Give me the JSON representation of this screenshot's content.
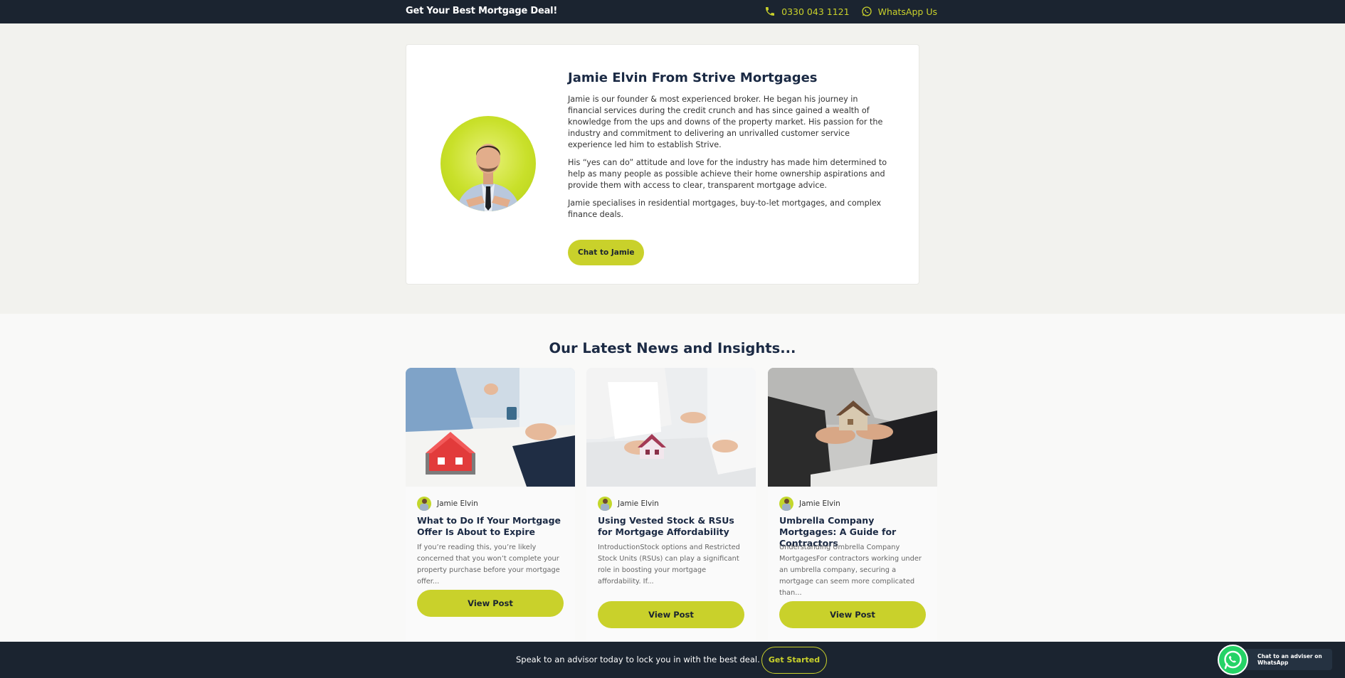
{
  "topbar": {
    "brand": "Get Your Best Mortgage Deal!",
    "phone": "0330 043 1121",
    "whatsapp": "WhatsApp Us",
    "accent": "#c9d12b",
    "background": "#1b2430"
  },
  "profile": {
    "title": "Jamie Elvin From Strive Mortgages",
    "paragraphs": [
      "Jamie is our founder & most experienced broker. He began his journey in financial services during the credit crunch and has since gained a wealth of knowledge from the ups and downs of the property market. His passion for the industry and commitment to delivering an unrivalled customer service experience led him to establish Strive.",
      "His “yes can do” attitude and love for the industry has made him determined to help as many people as possible achieve their home ownership aspirations and provide them with access to clear, transparent mortgage advice.",
      "Jamie specialises in residential mortgages, buy-to-let mortgages, and complex finance deals."
    ],
    "cta": "Chat to Jamie"
  },
  "news": {
    "title": "Our Latest News and Insights...",
    "posts": [
      {
        "author": "Jamie Elvin",
        "title": "What to Do If Your Mortgage Offer Is About to Expire",
        "excerpt": "If you’re reading this, you’re likely concerned that you won’t complete your property purchase before your mortgage offer...",
        "button": "View Post"
      },
      {
        "author": "Jamie Elvin",
        "title": "Using Vested Stock & RSUs for Mortgage Affordability",
        "excerpt": "IntroductionStock options and Restricted Stock Units (RSUs) can play a significant role in boosting your mortgage affordability. If...",
        "button": "View Post"
      },
      {
        "author": "Jamie Elvin",
        "title": "Umbrella Company Mortgages: A Guide for Contractors",
        "excerpt": "Understanding Umbrella Company MortgagesFor contractors working under an umbrella company, securing a mortgage can seem more complicated than...",
        "button": "View Post"
      }
    ]
  },
  "bottombar": {
    "message": "Speak to an advisor today to lock you in with the best deal.",
    "cta": "Get Started",
    "whatsapp_widget": "Chat to an adviser on WhatsApp"
  }
}
